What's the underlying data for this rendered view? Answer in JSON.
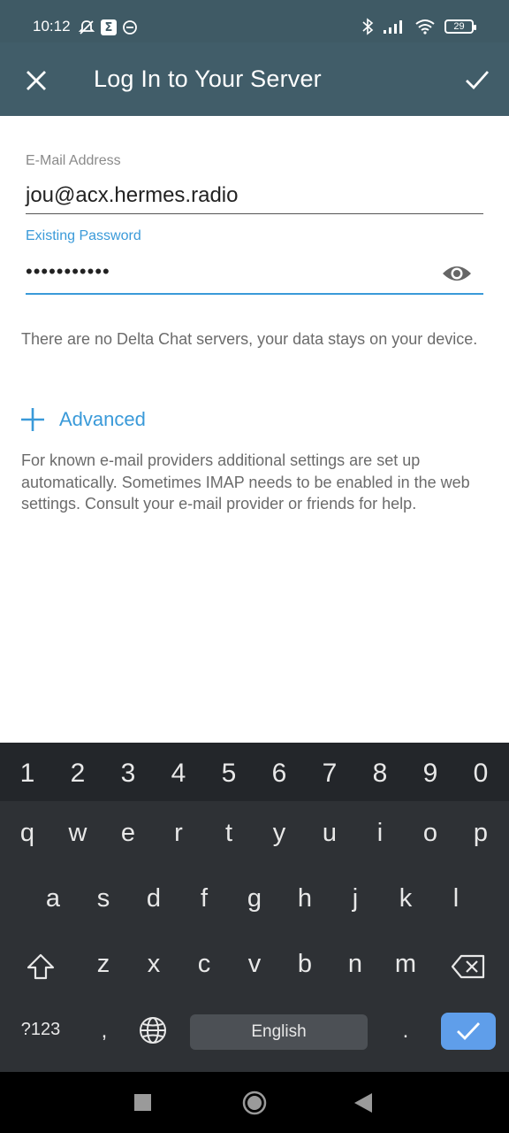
{
  "status_bar": {
    "time": "10:12",
    "battery": "29",
    "icons": [
      "mute-icon",
      "sigma-icon",
      "circle-dot-icon",
      "bluetooth-icon",
      "signal-icon",
      "wifi-icon",
      "battery-icon"
    ]
  },
  "app_bar": {
    "title": "Log In to Your Server",
    "close_icon": "close-icon",
    "confirm_icon": "check-icon"
  },
  "form": {
    "email_label": "E-Mail Address",
    "email_value": "jou@acx.hermes.radio",
    "password_label": "Existing Password",
    "password_value": "•••••••••••",
    "show_password_icon": "eye-icon",
    "accent_color": "#3a9ad9"
  },
  "info_text": "There are no Delta Chat servers, your data stays on your device.",
  "advanced": {
    "label": "Advanced",
    "icon": "plus-icon"
  },
  "help_text": "For known e-mail providers additional settings are set up automatically. Sometimes IMAP needs to be enabled in the web settings. Consult your e-mail provider or friends for help.",
  "keyboard": {
    "number_row": [
      "1",
      "2",
      "3",
      "4",
      "5",
      "6",
      "7",
      "8",
      "9",
      "0"
    ],
    "row1": [
      "q",
      "w",
      "e",
      "r",
      "t",
      "y",
      "u",
      "i",
      "o",
      "p"
    ],
    "row2": [
      "a",
      "s",
      "d",
      "f",
      "g",
      "h",
      "j",
      "k",
      "l"
    ],
    "row3": [
      "z",
      "x",
      "c",
      "v",
      "b",
      "n",
      "m"
    ],
    "symbols_key": "?123",
    "comma_key": ",",
    "space_label": "English",
    "period_key": ".",
    "enter_color": "#5f9eea"
  },
  "nav_bar": {
    "icons": [
      "recents-square-icon",
      "home-circle-icon",
      "back-triangle-icon"
    ]
  }
}
